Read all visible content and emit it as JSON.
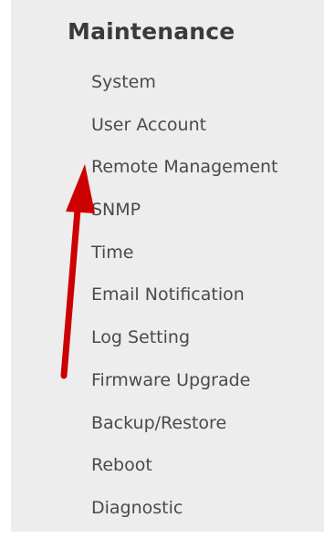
{
  "menu": {
    "title": "Maintenance",
    "items": [
      {
        "label": "System"
      },
      {
        "label": "User Account"
      },
      {
        "label": "Remote Management"
      },
      {
        "label": "SNMP"
      },
      {
        "label": "Time"
      },
      {
        "label": "Email Notification"
      },
      {
        "label": "Log Setting"
      },
      {
        "label": "Firmware Upgrade"
      },
      {
        "label": "Backup/Restore"
      },
      {
        "label": "Reboot"
      },
      {
        "label": "Diagnostic"
      }
    ]
  },
  "annotation": {
    "arrow_color": "#cc0000"
  }
}
